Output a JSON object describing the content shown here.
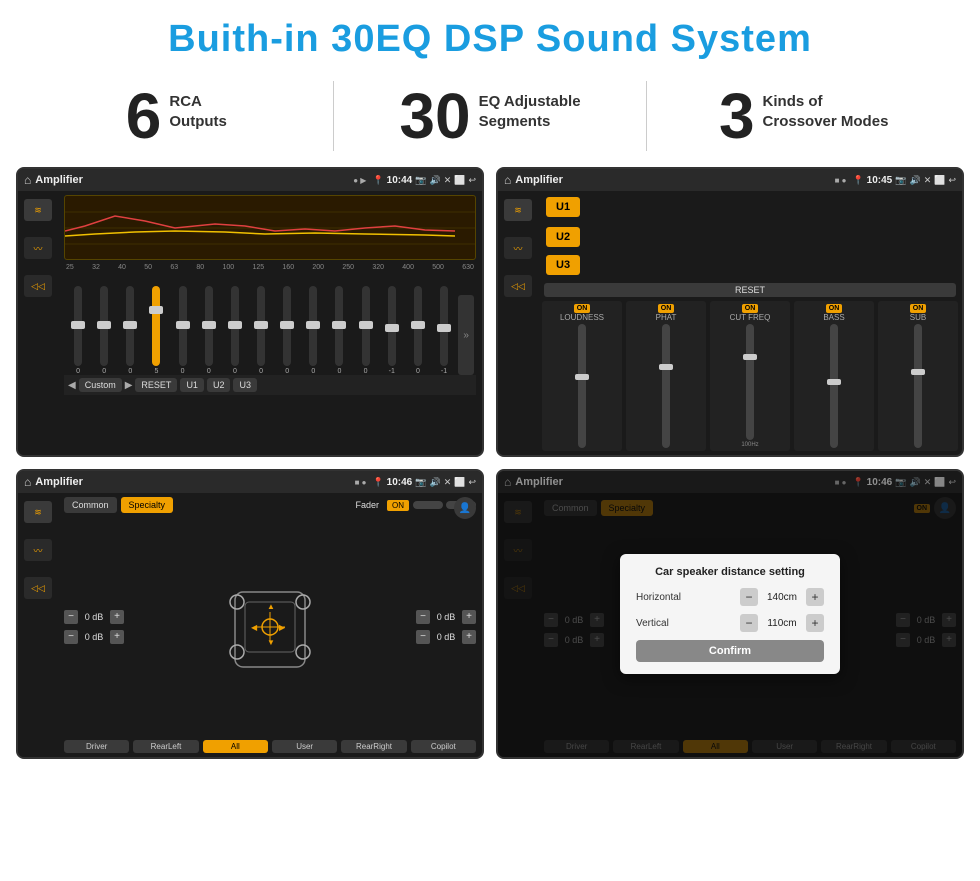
{
  "page": {
    "title": "Buith-in 30EQ DSP Sound System",
    "stats": [
      {
        "number": "6",
        "label": "RCA\nOutputs"
      },
      {
        "number": "30",
        "label": "EQ Adjustable\nSegments"
      },
      {
        "number": "3",
        "label": "Kinds of\nCrossover Modes"
      }
    ]
  },
  "screen1": {
    "title": "Amplifier",
    "time": "10:44",
    "eq_freqs": [
      "25",
      "32",
      "40",
      "50",
      "63",
      "80",
      "100",
      "125",
      "160",
      "200",
      "250",
      "320",
      "400",
      "500",
      "630"
    ],
    "eq_values": [
      "0",
      "0",
      "0",
      "5",
      "0",
      "0",
      "0",
      "0",
      "0",
      "0",
      "0",
      "0",
      "-1",
      "0",
      "-1"
    ],
    "bottom_buttons": [
      "Custom",
      "RESET",
      "U1",
      "U2",
      "U3"
    ]
  },
  "screen2": {
    "title": "Amplifier",
    "time": "10:45",
    "u_buttons": [
      "U1",
      "U2",
      "U3"
    ],
    "channels": [
      {
        "label": "LOUDNESS",
        "on": true
      },
      {
        "label": "PHAT",
        "on": true
      },
      {
        "label": "CUT FREQ",
        "on": true
      },
      {
        "label": "BASS",
        "on": true
      },
      {
        "label": "SUB",
        "on": true
      }
    ],
    "reset_label": "RESET"
  },
  "screen3": {
    "title": "Amplifier",
    "time": "10:46",
    "tabs": [
      "Common",
      "Specialty"
    ],
    "fader_label": "Fader",
    "fader_on": true,
    "left_db": [
      "0 dB",
      "0 dB"
    ],
    "right_db": [
      "0 dB",
      "0 dB"
    ],
    "buttons": [
      "Driver",
      "RearLeft",
      "All",
      "User",
      "RearRight",
      "Copilot"
    ]
  },
  "screen4": {
    "title": "Amplifier",
    "time": "10:46",
    "tabs": [
      "Common",
      "Specialty"
    ],
    "dialog": {
      "title": "Car speaker distance setting",
      "horizontal_label": "Horizontal",
      "horizontal_value": "140cm",
      "vertical_label": "Vertical",
      "vertical_value": "110cm",
      "confirm_label": "Confirm"
    },
    "left_db": [
      "0 dB",
      "0 dB"
    ],
    "right_db": [
      "0 dB",
      "0 dB"
    ],
    "buttons": [
      "Driver",
      "RearLeft",
      "All",
      "User",
      "RearRight",
      "Copilot"
    ]
  },
  "icons": {
    "home": "⌂",
    "back": "↩",
    "location": "📍",
    "camera": "📷",
    "speaker": "🔊",
    "close": "✕",
    "window": "⬜",
    "eq": "≋",
    "wave": "〰",
    "volume": "◁◁",
    "play": "▶",
    "prev": "◀",
    "minus": "−",
    "plus": "+",
    "chevron_down": "▼",
    "chevron_up": "▲",
    "person": "👤"
  }
}
